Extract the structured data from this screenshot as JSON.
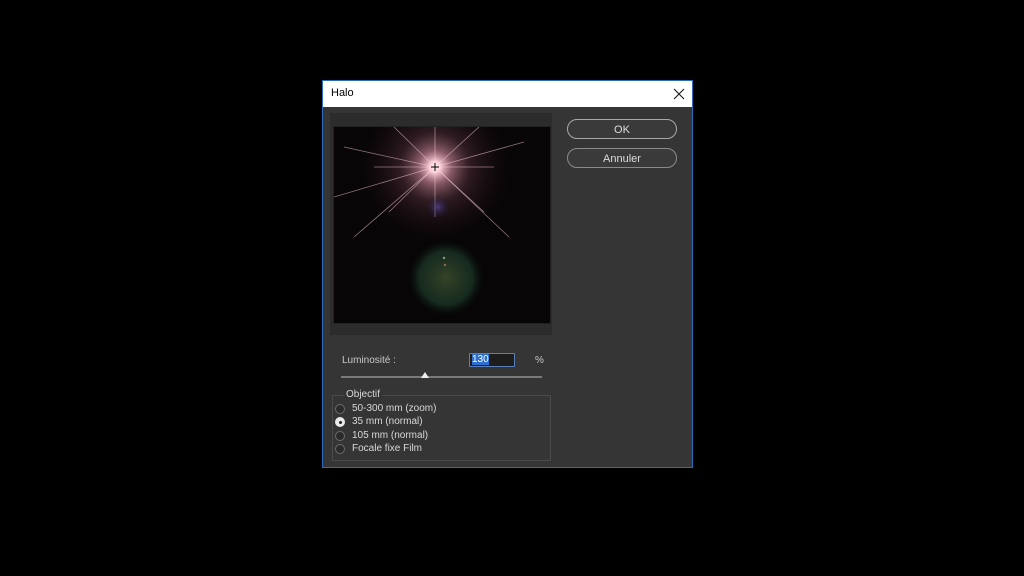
{
  "dialog": {
    "title": "Halo",
    "ok_label": "OK",
    "cancel_label": "Annuler"
  },
  "brightness": {
    "label": "Luminosité :",
    "value": "130",
    "unit": "%",
    "slider_fraction": 0.42
  },
  "lens": {
    "group_title": "Objectif",
    "options": [
      {
        "label": "50-300 mm (zoom)",
        "selected": false
      },
      {
        "label": "35 mm (normal)",
        "selected": true
      },
      {
        "label": "105 mm  (normal)",
        "selected": false
      },
      {
        "label": "Focale fixe Film",
        "selected": false
      }
    ]
  },
  "icons": {
    "close": "close-icon",
    "flare_center": "crosshair-icon"
  },
  "colors": {
    "dialog_bg": "#353535",
    "border_accent": "#2a6ebb",
    "input_selection": "#2b6fd0"
  }
}
